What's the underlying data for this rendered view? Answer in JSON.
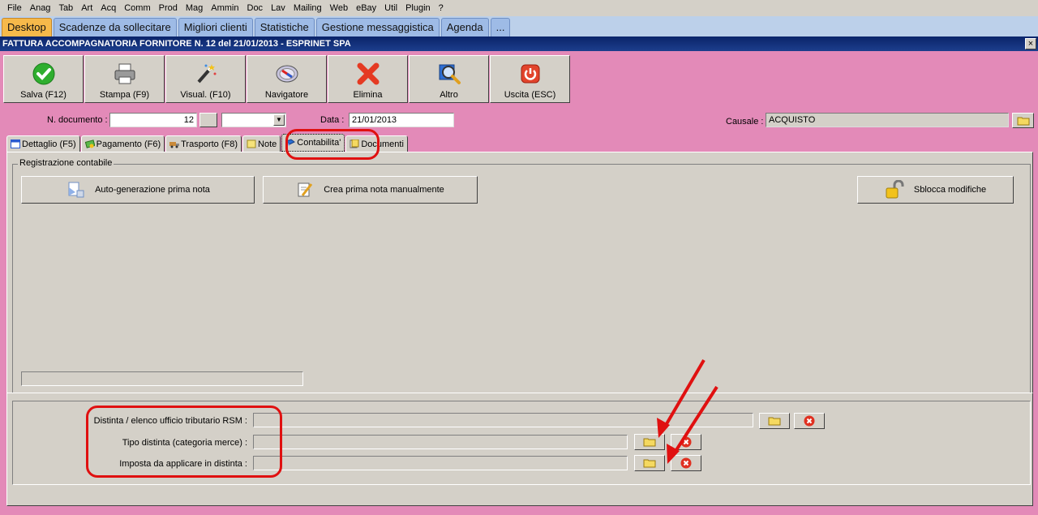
{
  "menu": [
    "File",
    "Anag",
    "Tab",
    "Art",
    "Acq",
    "Comm",
    "Prod",
    "Mag",
    "Ammin",
    "Doc",
    "Lav",
    "Mailing",
    "Web",
    "eBay",
    "Util",
    "Plugin",
    "?"
  ],
  "app_tabs": [
    "Desktop",
    "Scadenze da sollecitare",
    "Migliori clienti",
    "Statistiche",
    "Gestione messaggistica",
    "Agenda",
    "..."
  ],
  "window_title": "FATTURA ACCOMPAGNATORIA FORNITORE N. 12 del 21/01/2013 - ESPRINET SPA",
  "window_close": "×",
  "toolbar": [
    {
      "label": "Salva (F12)",
      "icon": "check-icon"
    },
    {
      "label": "Stampa (F9)",
      "icon": "printer-icon"
    },
    {
      "label": "Visual. (F10)",
      "icon": "magic-wand-icon"
    },
    {
      "label": "Navigatore",
      "icon": "compass-icon"
    },
    {
      "label": "Elimina",
      "icon": "delete-x-icon"
    },
    {
      "label": "Altro",
      "icon": "magnifier-icon"
    },
    {
      "label": "Uscita (ESC)",
      "icon": "power-icon"
    }
  ],
  "header": {
    "ndoc_label": "N. documento :",
    "ndoc_value": "12",
    "data_label": "Data :",
    "data_value": "21/01/2013",
    "causale_label": "Causale :",
    "causale_value": "ACQUISTO"
  },
  "form_tabs": [
    "Dettaglio (F5)",
    "Pagamento (F6)",
    "Trasporto (F8)",
    "Note",
    "Contabilita'",
    "Documenti"
  ],
  "group": {
    "label": "Registrazione contabile",
    "btn_auto": "Auto-generazione prima nota",
    "btn_manual": "Crea prima nota manualmente",
    "btn_unlock": "Sblocca modifiche"
  },
  "lower": {
    "distinta_label": "Distinta / elenco ufficio tributario RSM :",
    "tipo_label": "Tipo distinta (categoria merce) :",
    "imposta_label": "Imposta da applicare in distinta :"
  },
  "colors": {
    "accent_tab": "#f6b94a",
    "background": "#e38ab8",
    "annotation": "#e01010"
  }
}
